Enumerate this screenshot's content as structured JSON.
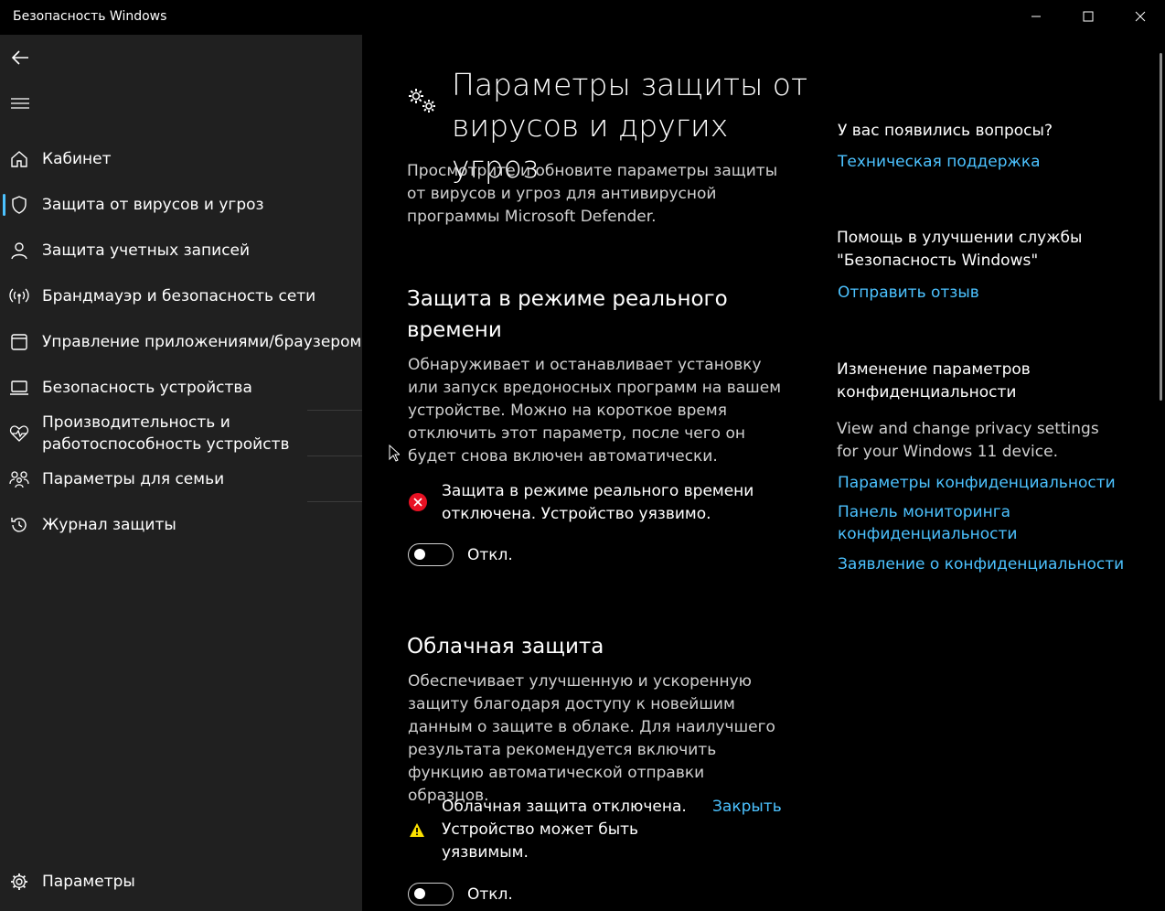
{
  "window": {
    "title": "Безопасность Windows"
  },
  "sidebar": {
    "back_icon": "back-arrow-icon",
    "menu_icon": "hamburger-menu-icon",
    "items": [
      {
        "label": "Кабинет",
        "icon": "home-icon"
      },
      {
        "label": "Защита от вирусов и угроз",
        "icon": "shield-icon",
        "active": true
      },
      {
        "label": "Защита учетных записей",
        "icon": "person-icon"
      },
      {
        "label": "Брандмауэр и безопасность сети",
        "icon": "wifi-antenna-icon"
      },
      {
        "label": "Управление приложениями/браузером",
        "icon": "app-window-icon"
      },
      {
        "label": "Безопасность устройства",
        "icon": "laptop-icon"
      },
      {
        "label": "Производительность и работоспособность устройств",
        "icon": "heart-pulse-icon"
      },
      {
        "label": "Параметры для семьи",
        "icon": "family-icon"
      },
      {
        "label": "Журнал защиты",
        "icon": "history-icon"
      }
    ],
    "settings_label": "Параметры"
  },
  "main": {
    "title": "Параметры защиты от вирусов и других угроз",
    "description": "Просмотрите и обновите параметры защиты от вирусов и угроз для антивирусной программы Microsoft Defender.",
    "realtime": {
      "heading": "Защита в режиме реального времени",
      "description": "Обнаруживает и останавливает установку или запуск вредоносных программ на вашем устройстве. Можно на короткое время отключить этот параметр, после чего он будет снова включен автоматически.",
      "status": "Защита в режиме реального времени отключена. Устройство уязвимо.",
      "toggle_label": "Откл.",
      "toggle_on": false
    },
    "cloud": {
      "heading": "Облачная защита",
      "description": "Обеспечивает улучшенную и ускоренную защиту благодаря доступу к новейшим данным о защите в облаке. Для наилучшего результата рекомендуется включить функцию автоматической отправки образцов.",
      "status": "Облачная защита отключена. Устройство может быть уязвимым.",
      "dismiss_label": "Закрыть",
      "toggle_label": "Откл.",
      "toggle_on": false
    }
  },
  "right_panel": {
    "questions_heading": "У вас появились вопросы?",
    "support_link": "Техническая поддержка",
    "improve_heading": "Помощь в улучшении службы \"Безопасность Windows\"",
    "feedback_link": "Отправить отзыв",
    "privacy_heading": "Изменение параметров конфиденциальности",
    "privacy_text": "View and change privacy settings for your Windows 11 device.",
    "privacy_links": [
      "Параметры конфиденциальности",
      "Панель мониторинга конфиденциальности",
      "Заявление о конфиденциальности"
    ]
  },
  "colors": {
    "accent": "#4cc2ff",
    "error": "#e81123",
    "warning": "#fce100"
  }
}
